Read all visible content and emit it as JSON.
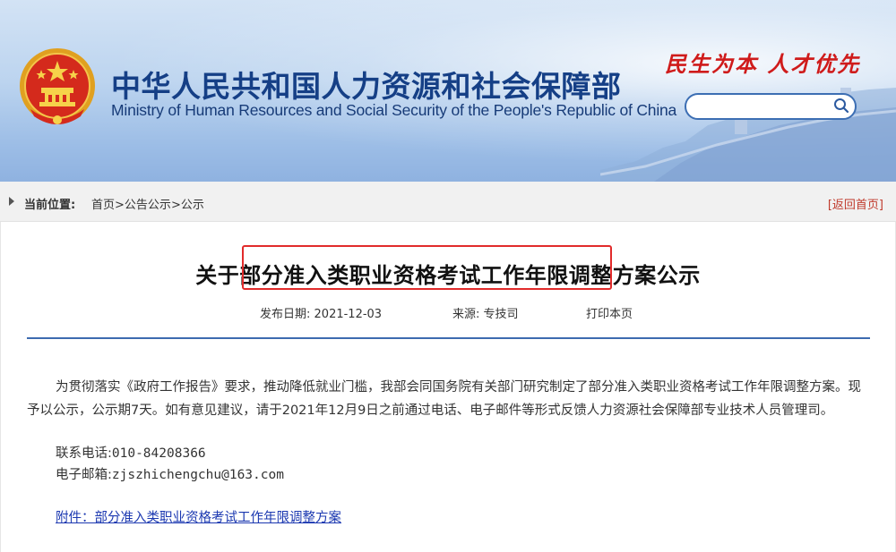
{
  "header": {
    "title_cn": "中华人民共和国人力资源和社会保障部",
    "title_en": "Ministry of Human Resources and Social Security of the People's Republic of China",
    "slogan": "民生为本 人才优先",
    "search": {
      "placeholder": "",
      "value": ""
    },
    "emblem_icon": "national-emblem-icon",
    "search_icon": "search-icon"
  },
  "breadcrumb": {
    "label": "当前位置:",
    "items": [
      "首页",
      "公告公示",
      "公示"
    ],
    "separator": ">",
    "back_home": "[返回首页]"
  },
  "article": {
    "title": "关于部分准入类职业资格考试工作年限调整方案公示",
    "highlighted_phrase": "部分准入类职业资格考试工作年限调整",
    "publish_date_label": "发布日期:",
    "publish_date": "2021-12-03",
    "source_label": "来源:",
    "source": "专技司",
    "print_label": "打印本页",
    "body": "为贯彻落实《政府工作报告》要求，推动降低就业门槛，我部会同国务院有关部门研究制定了部分准入类职业资格考试工作年限调整方案。现予以公示，公示期7天。如有意见建议，请于2021年12月9日之前通过电话、电子邮件等形式反馈人力资源社会保障部专业技术人员管理司。",
    "phone_label": "联系电话:",
    "phone": "010-84208366",
    "email_label": "电子邮箱:",
    "email": "zjszhichengchu@163.com",
    "attachment": "附件：部分准入类职业资格考试工作年限调整方案"
  },
  "colors": {
    "title_blue": "#153f86",
    "slogan_red": "#cf1b1b",
    "rule_blue": "#3d6bb0",
    "highlight_red": "#e12b2b",
    "link_blue": "#1a37b0"
  }
}
